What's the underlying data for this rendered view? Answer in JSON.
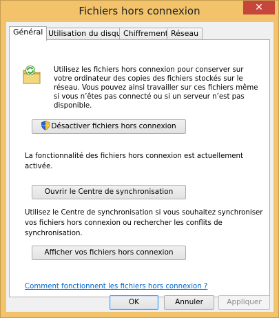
{
  "window": {
    "title": "Fichiers hors connexion",
    "close_label": "✕"
  },
  "tabs": [
    {
      "label": "Général",
      "active": true
    },
    {
      "label": "Utilisation du disque",
      "active": false
    },
    {
      "label": "Chiffrement",
      "active": false
    },
    {
      "label": "Réseau",
      "active": false
    }
  ],
  "general": {
    "intro": "Utilisez les fichiers hors connexion pour conserver sur votre ordinateur des copies des fichiers stockés sur le réseau. Vous pouvez ainsi travailler sur ces fichiers même si vous n’êtes pas connecté ou si un serveur n’est pas disponible.",
    "disable_button": "Désactiver fichiers hors connexion",
    "status_text": "La fonctionnalité des fichiers hors connexion est actuellement activée.",
    "sync_center_button": "Ouvrir le Centre de synchronisation",
    "sync_text": "Utilisez le Centre de synchronisation si vous souhaitez synchroniser vos fichiers hors connexion ou rechercher les conflits de synchronisation.",
    "view_files_button": "Afficher vos fichiers hors connexion",
    "help_link": "Comment fonctionnent les fichiers hors connexion ?"
  },
  "footer": {
    "ok": "OK",
    "cancel": "Annuler",
    "apply": "Appliquer"
  },
  "colors": {
    "titlebar": "#f2c36b",
    "close": "#c7463b",
    "link": "#0066cc"
  },
  "icons": [
    "offline-files-icon",
    "uac-shield-icon",
    "close-icon"
  ]
}
